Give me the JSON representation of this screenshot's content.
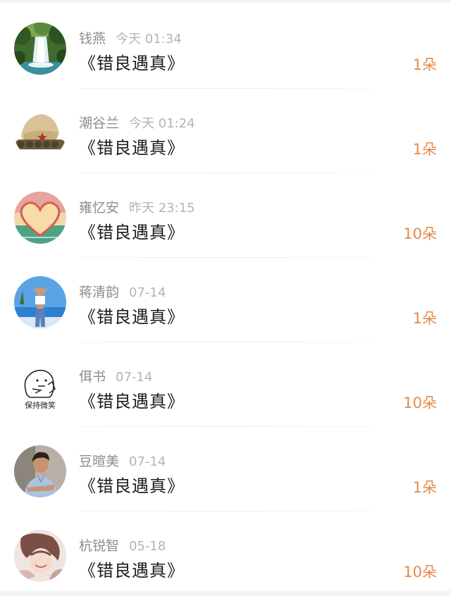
{
  "records": [
    {
      "name": "钱燕",
      "time": "今天 01:34",
      "title": "《错良遇真》",
      "count": "1朵",
      "avatar": "waterfall-photo"
    },
    {
      "name": "潮谷兰",
      "time": "今天 01:24",
      "title": "《错良遇真》",
      "count": "1朵",
      "avatar": "army-cap-photo"
    },
    {
      "name": "雍忆安",
      "time": "昨天 23:15",
      "title": "《错良遇真》",
      "count": "10朵",
      "avatar": "heart-drawing"
    },
    {
      "name": "蒋清韵",
      "time": "07-14",
      "title": "《错良遇真》",
      "count": "1朵",
      "avatar": "beach-person-photo"
    },
    {
      "name": "佴书",
      "time": "07-14",
      "title": "《错良遇真》",
      "count": "10朵",
      "avatar": "keep-smiling-doodle"
    },
    {
      "name": "豆暄美",
      "time": "07-14",
      "title": "《错良遇真》",
      "count": "1朵",
      "avatar": "man-portrait-photo"
    },
    {
      "name": "杭锐智",
      "time": "05-18",
      "title": "《错良遇真》",
      "count": "10朵",
      "avatar": "anime-illustration"
    }
  ],
  "avatar_caption": "保持微笑",
  "colors": {
    "name": "#8c8c8c",
    "time": "#b4b4b4",
    "title": "#1c1c1c",
    "count": "#e58a47",
    "divider": "#eeeeee"
  }
}
